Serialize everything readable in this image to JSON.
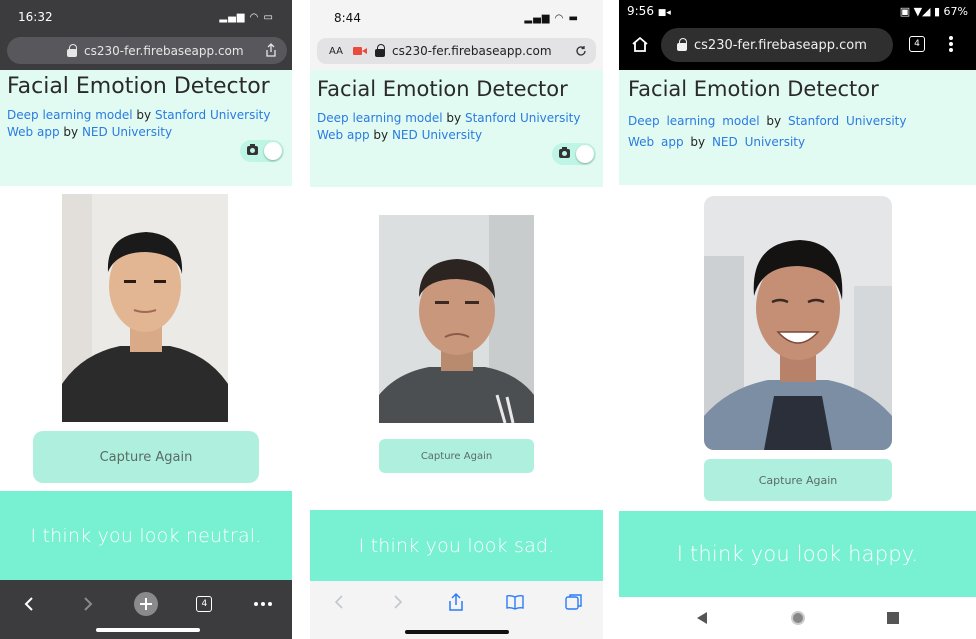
{
  "app": {
    "title": "Facial Emotion Detector",
    "url": "cs230-fer.firebaseapp.com",
    "credit1_link": "Deep learning model",
    "credit1_by": "by",
    "credit1_org": "Stanford University",
    "credit2_link": "Web app",
    "credit2_by": "by",
    "credit2_org": "NED University",
    "capture_label": "Capture Again"
  },
  "phones": [
    {
      "time": "16:32",
      "tab_count": "4",
      "result": "I think you look neutral."
    },
    {
      "time": "8:44",
      "text_size": "AA",
      "result": "I think you look sad."
    },
    {
      "time": "9:56",
      "battery": "67%",
      "tab_count": "4",
      "result": "I think you look happy."
    }
  ],
  "colors": {
    "header_bg": "#e1fbf3",
    "result_bg": "#78f0d2",
    "button_bg": "#aef0dd",
    "link": "#2a7be0"
  }
}
